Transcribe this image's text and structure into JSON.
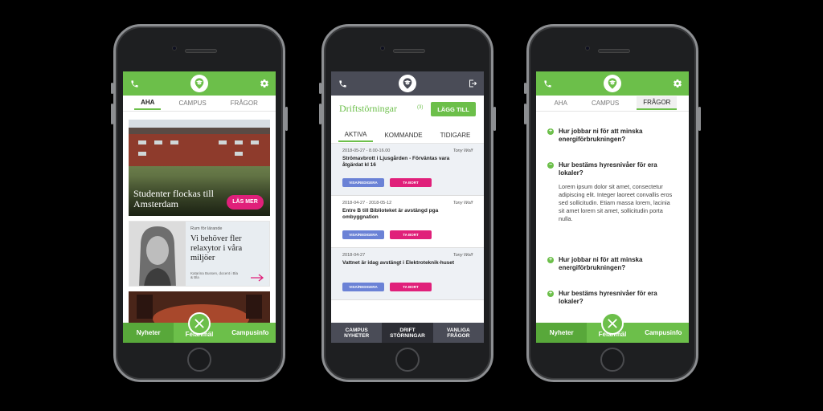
{
  "colors": {
    "brand_green": "#6cbf4a",
    "accent_pink": "#e0207a",
    "dark_header": "#4a4c57",
    "button_blue": "#6b82d6"
  },
  "phone1": {
    "header_icons": [
      "phone-icon",
      "logo-icon",
      "gear-icon"
    ],
    "tabs": [
      "AHA",
      "CAMPUS",
      "FRÅGOR"
    ],
    "card1": {
      "title": "Studenter flockas till Amsterdam",
      "button": "LÄS MER"
    },
    "card2": {
      "kicker": "Rum för lärande",
      "title": "Vi behöver fler relaxytor i våra miljöer",
      "byline": "Katarina Bussen, docent i Bla & Bla"
    },
    "bottom_nav": [
      "Nyheter",
      "Felanmäl",
      "Campusinfo"
    ]
  },
  "phone2": {
    "header_icons": [
      "phone-icon",
      "logo-icon",
      "logout-icon"
    ],
    "title": "Driftstörningar",
    "count": "(3)",
    "add_button": "LÄGG TILL",
    "tabs": [
      "AKTIVA",
      "KOMMANDE",
      "TIDIGARE"
    ],
    "items": [
      {
        "date": "2018-05-27 - 8.00-16.00",
        "author": "Tony Wolf",
        "text": "Strömavbrott i Ljusgården - Förväntas vara åtgärdat kl 16",
        "btn1": "VISA/REDIGERA",
        "btn2": "TA BORT"
      },
      {
        "date": "2018-04-27 - 2018-05-12",
        "author": "Tony Wolf",
        "text": "Entre B till Biblioteket är avstängd pga ombyggnation",
        "btn1": "VISA/REDIGERA",
        "btn2": "TA BORT"
      },
      {
        "date": "2018-04-27",
        "author": "Tony Wolf",
        "text": "Vattnet är idag avstängt i Elektroteknik-huset",
        "btn1": "VISA/REDIGERA",
        "btn2": "TA BORT"
      }
    ],
    "bottom_nav": [
      {
        "l1": "CAMPUS",
        "l2": "NYHETER"
      },
      {
        "l1": "DRIFT",
        "l2": "STÖRNINGAR"
      },
      {
        "l1": "VANLIGA",
        "l2": "FRÅGOR"
      }
    ]
  },
  "phone3": {
    "header_icons": [
      "phone-icon",
      "logo-icon",
      "gear-icon"
    ],
    "tabs": [
      "AHA",
      "CAMPUS",
      "FRÅGOR"
    ],
    "faqs": [
      {
        "q": "Hur jobbar ni för att minska energiförbrukningen?",
        "open": false
      },
      {
        "q": "Hur bestäms hyresnivåer för era lokaler?",
        "open": true,
        "answer": "Lorem ipsum dolor sit amet, consectetur adipiscing elit. Integer laoreet convallis eros sed sollicitudin. Etiam massa lorem, lacinia sit amet lorem sit amet, sollicitudin porta nulla."
      },
      {
        "q": "Hur jobbar ni för att minska energiförbrukningen?",
        "open": false
      },
      {
        "q": "Hur bestäms hyresnivåer för era lokaler?",
        "open": false
      }
    ],
    "bottom_nav": [
      "Nyheter",
      "Felanmäl",
      "Campusinfo"
    ]
  }
}
